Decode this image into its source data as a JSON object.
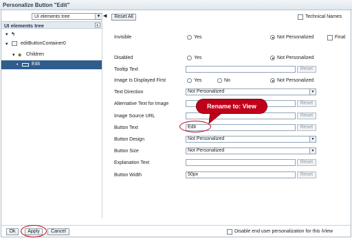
{
  "window": {
    "title": "Personalize Button \"Edit\""
  },
  "left_pane": {
    "view_select": "UI elements tree",
    "header": "UI elements tree",
    "tree": [
      {
        "label": "",
        "level": 0,
        "icon": "hierarchy-icon"
      },
      {
        "label": "editButtonContainer0",
        "level": 1,
        "icon": "container-icon"
      },
      {
        "label": "Children",
        "level": 2,
        "icon": "folder-icon"
      },
      {
        "label": "Edit",
        "level": 3,
        "icon": "button-icon",
        "selected": true
      }
    ]
  },
  "toolbar": {
    "reset_all": "Reset All",
    "technical_names": "Technical Names"
  },
  "props": {
    "invisible": {
      "label": "Invisible",
      "yes": "Yes",
      "not_personalized": "Not Personalized",
      "final": "Final"
    },
    "disabled": {
      "label": "Disabled",
      "yes": "Yes",
      "not_personalized": "Not Personalized"
    },
    "tooltip": {
      "label": "Tooltip Text",
      "value": ""
    },
    "image_first": {
      "label": "Image Is Displayed First",
      "yes": "Yes",
      "no": "No",
      "not_personalized": "Not Personalized"
    },
    "text_direction": {
      "label": "Text Direction",
      "value": "Not Personalized"
    },
    "alt_text": {
      "label": "Alternative Text for Image",
      "value": ""
    },
    "image_source": {
      "label": "Image Source URL",
      "value": ""
    },
    "button_text": {
      "label": "Button Text",
      "value": "Edit"
    },
    "button_design": {
      "label": "Button Design",
      "value": "Not Personalized"
    },
    "button_size": {
      "label": "Button Size",
      "value": "Not Personalized"
    },
    "explanation": {
      "label": "Explanation Text",
      "value": ""
    },
    "button_width": {
      "label": "Button Width",
      "value": "50px"
    },
    "reset_label": "Reset"
  },
  "annotation": {
    "callout": "Rename to: View",
    "color": "#c0001a"
  },
  "footer": {
    "ok": "Ok",
    "apply": "Apply",
    "cancel": "Cancel",
    "disable_personalization": "Disable end user personalization for this iView"
  }
}
